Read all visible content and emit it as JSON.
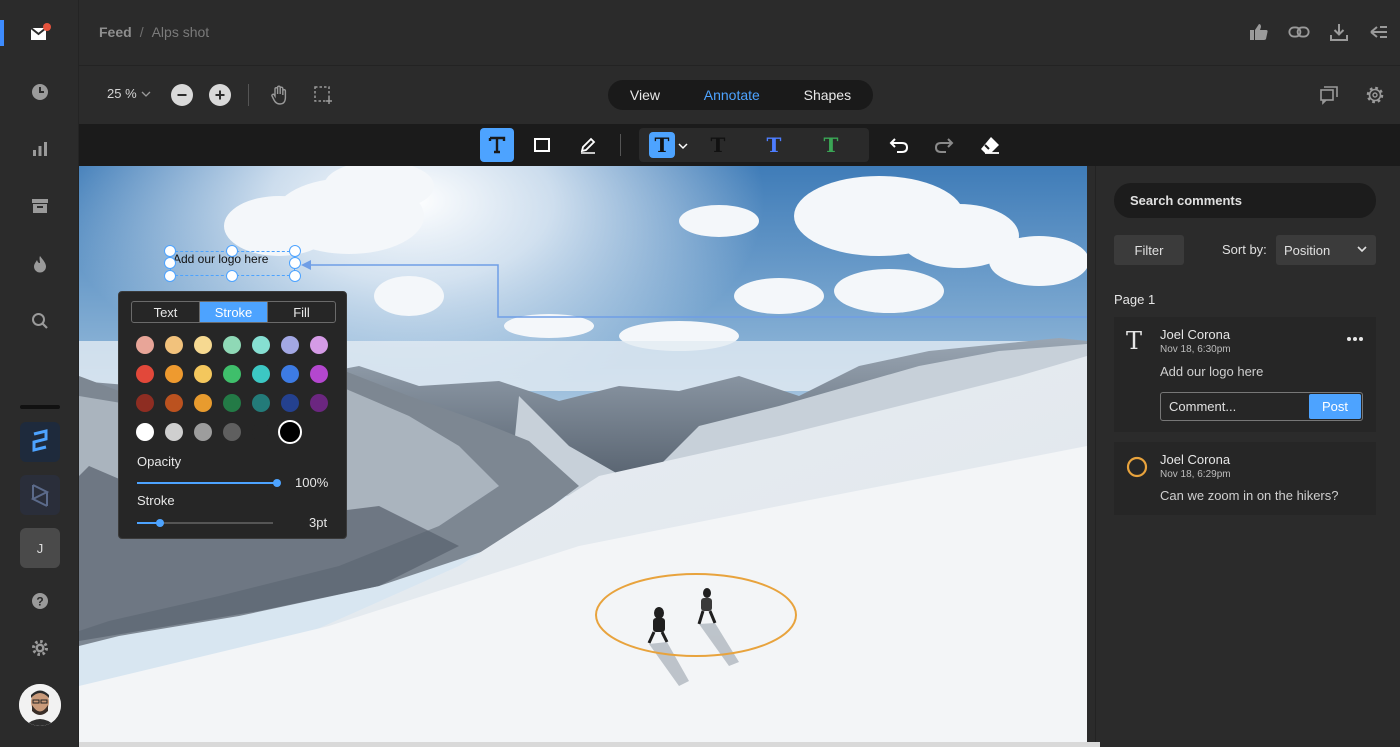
{
  "breadcrumb": {
    "root": "Feed",
    "separator": "/",
    "current": "Alps shot"
  },
  "toolbar": {
    "zoom_label": "25 %",
    "modes": [
      {
        "label": "View",
        "active": false
      },
      {
        "label": "Annotate",
        "active": true
      },
      {
        "label": "Shapes",
        "active": false
      }
    ]
  },
  "annotate_tools": {
    "text_styles": [
      "T",
      "T",
      "T",
      "T"
    ],
    "text_style_colors": [
      "#ffffff",
      "#111111",
      "#4d7dff",
      "#3aa655"
    ]
  },
  "canvas": {
    "text_annotation": "Add our logo here",
    "ellipse_color": "#e8a33d",
    "leader_line_color": "#6f9ee6"
  },
  "popover": {
    "tabs": [
      {
        "label": "Text",
        "active": false
      },
      {
        "label": "Stroke",
        "active": true
      },
      {
        "label": "Fill",
        "active": false
      }
    ],
    "palette": [
      [
        "#e8a598",
        "#f2c27c",
        "#f6d991",
        "#8fd9b6",
        "#86dfd2",
        "#a3a8e4",
        "#d59be6"
      ],
      [
        "#e2483a",
        "#ee9a2f",
        "#f4c75d",
        "#3fbf6b",
        "#3cc7c3",
        "#3d7be3",
        "#b447cf"
      ],
      [
        "#8e2d22",
        "#bb521f",
        "#e89b2e",
        "#237a46",
        "#237b79",
        "#24418f",
        "#6b2680"
      ],
      [
        "#ffffff",
        "#cfcfcf",
        "#9d9d9d",
        "#5f5f5f",
        "#262626",
        "#000000"
      ]
    ],
    "selected_color": "#000000",
    "opacity_label": "Opacity",
    "opacity_value": "100%",
    "opacity_fraction": 1.0,
    "stroke_label": "Stroke",
    "stroke_value": "3pt",
    "stroke_fraction": 0.17
  },
  "panel": {
    "search_placeholder": "Search comments",
    "filter_label": "Filter",
    "sort_label": "Sort by:",
    "sort_value": "Position",
    "page_label": "Page 1",
    "comments": [
      {
        "type_icon": "T",
        "author": "Joel Corona",
        "date": "Nov 18, 6:30pm",
        "text": "Add our logo here",
        "input_placeholder": "Comment...",
        "post_label": "Post"
      },
      {
        "type_icon": "circle",
        "author": "Joel Corona",
        "date": "Nov 18, 6:29pm",
        "text": "Can we zoom in on the hikers?"
      }
    ]
  },
  "workspaces": {
    "user_initial": "J"
  },
  "colors": {
    "accent": "#4da3ff",
    "background": "#2b2b2b",
    "notification": "#e5533d"
  }
}
